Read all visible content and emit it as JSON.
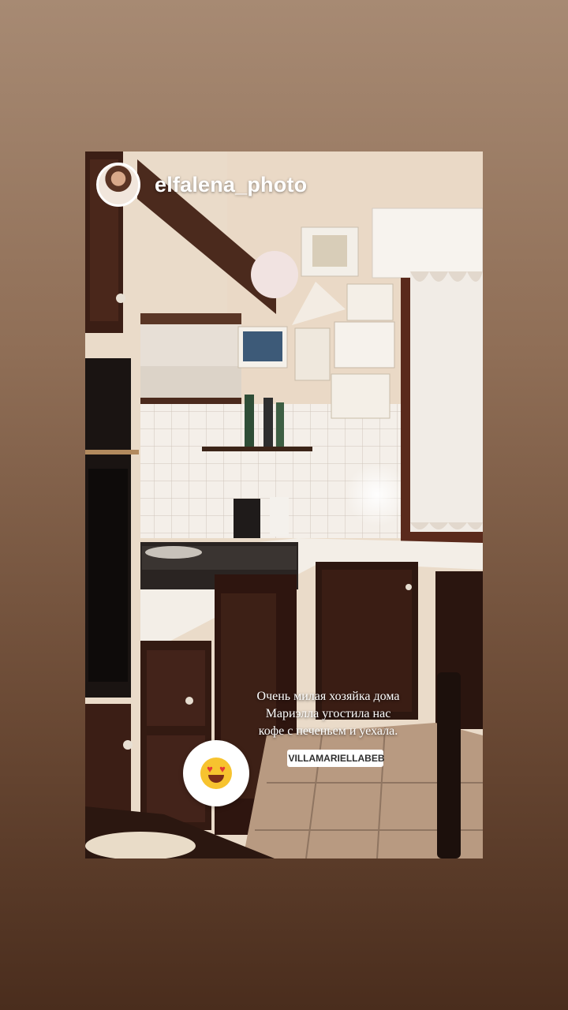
{
  "story": {
    "username": "elfalena_photo",
    "caption_lines": [
      "Очень милая хозяйка дома",
      "Мариэлла угостила нас",
      "кофе с печеньем и уехала."
    ],
    "mention_tag": "VILLAMARIELLABEB",
    "sticker_icon": "heart-eyes-emoji-icon"
  },
  "colors": {
    "background_top": "#a78a73",
    "background_bottom": "#4a2d1d",
    "cabinet_wood": "#3b1e15",
    "tile": "#f2ede7",
    "wall": "#eadbc9"
  }
}
